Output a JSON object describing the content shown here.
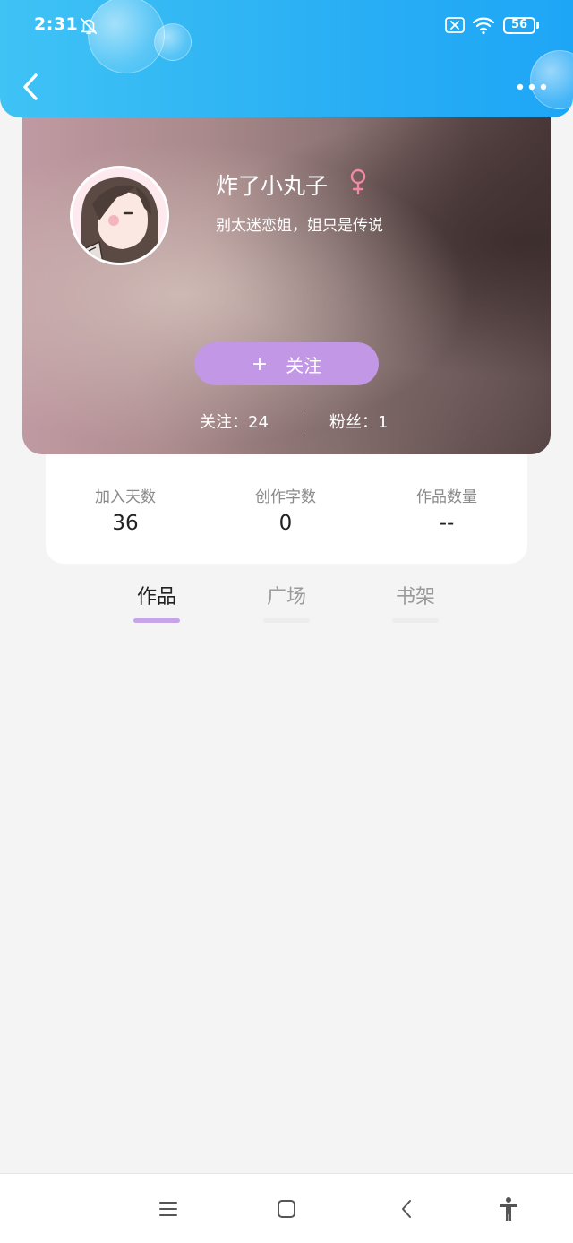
{
  "status_bar": {
    "time": "2:31",
    "battery": "56",
    "icons": [
      "bell-off-icon",
      "sim-x-icon",
      "wifi-icon",
      "battery-icon"
    ]
  },
  "app_bar": {
    "icons": [
      "back-icon",
      "more-icon"
    ],
    "accent_color": "#2bb0f4"
  },
  "profile": {
    "nickname": "炸了小丸子",
    "gender_icon": "female-icon",
    "bio": "别太迷恋姐，姐只是传说",
    "follow_plus": "+",
    "follow_label": "关注",
    "following": "关注：24",
    "fans": "粉丝：1",
    "button_color": "#c197e6"
  },
  "stats": [
    {
      "label": "加入天数",
      "value": "36"
    },
    {
      "label": "创作字数",
      "value": "0"
    },
    {
      "label": "作品数量",
      "value": "--"
    }
  ],
  "tabs": [
    {
      "label": "作品",
      "active": true
    },
    {
      "label": "广场",
      "active": false
    },
    {
      "label": "书架",
      "active": false
    }
  ],
  "nav_bar": {
    "icons": [
      "menu-icon",
      "home-icon",
      "back-nav-icon",
      "accessibility-icon"
    ]
  }
}
